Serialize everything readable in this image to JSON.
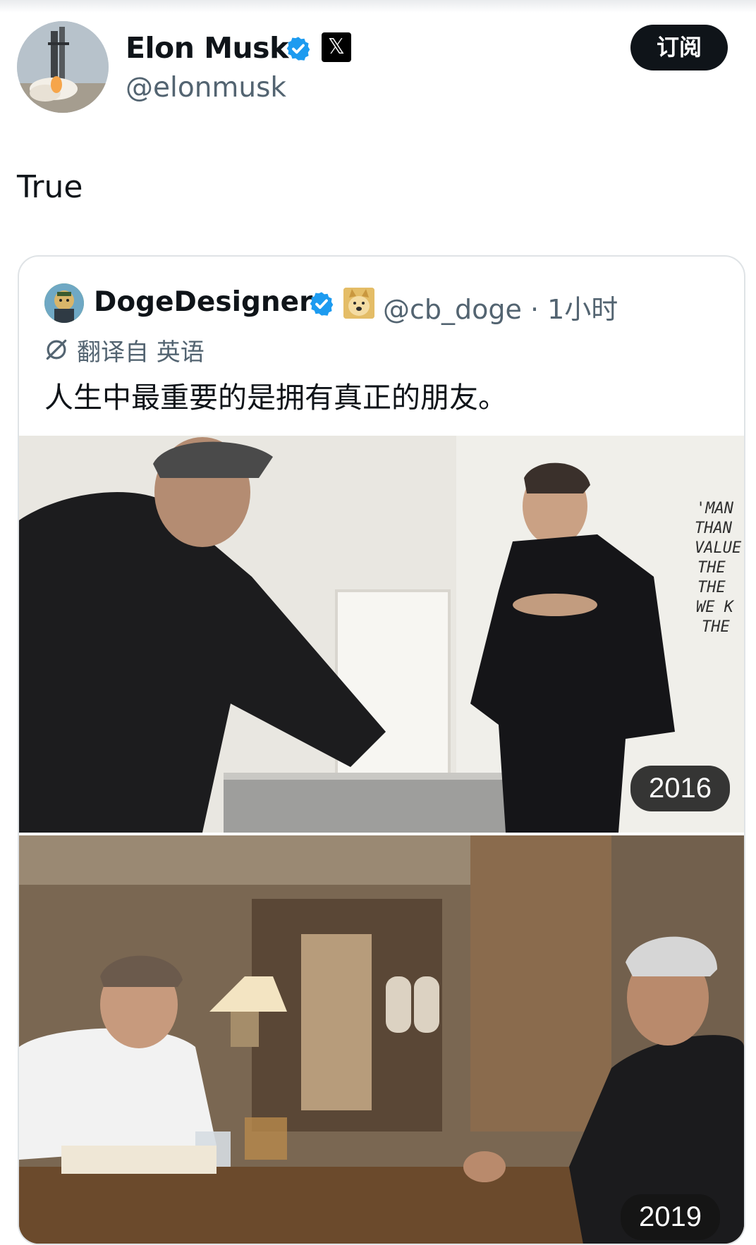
{
  "header": {
    "name": "Elon Musk",
    "handle": "@elonmusk",
    "subscribe_label": "订阅",
    "x_logo": "𝕏"
  },
  "tweet": {
    "text": "True"
  },
  "quote": {
    "name": "DogeDesigner",
    "handle_time": "@cb_doge · 1小时",
    "translate_label": "翻译自 英语",
    "text": "人生中最重要的是拥有真正的朋友。",
    "photos": [
      {
        "year": "2016"
      },
      {
        "year": "2019"
      }
    ]
  },
  "icons": [
    "verified-icon",
    "x-logo-icon",
    "translate-icon",
    "doge-emoji-icon"
  ],
  "colors": {
    "verified": "#1d9bf0",
    "subscribe_bg": "#0f1419",
    "secondary_text": "#536471"
  }
}
